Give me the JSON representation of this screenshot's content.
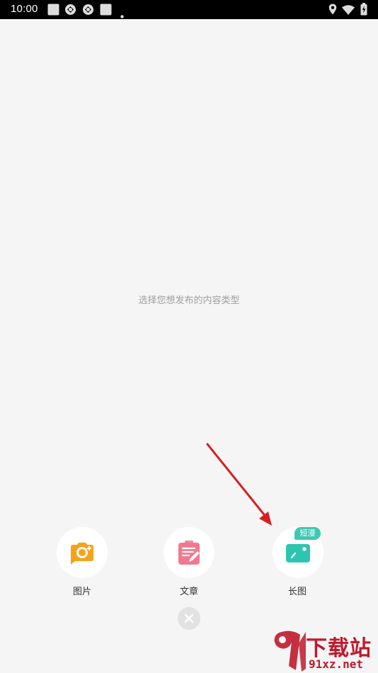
{
  "status_bar": {
    "time": "10:00",
    "left_icons": [
      "square-notification-icon",
      "sync-icon",
      "sync-icon",
      "square-notification-icon",
      "dot-icon"
    ],
    "right_icons": [
      "location-icon",
      "wifi-icon",
      "battery-icon"
    ]
  },
  "hint": "选择您想发布的内容类型",
  "options": [
    {
      "label": "图片",
      "icon": "camera-icon",
      "color": "#f6a21b"
    },
    {
      "label": "文章",
      "icon": "article-edit-icon",
      "color": "#ef5e7c"
    },
    {
      "label": "长图",
      "icon": "image-icon",
      "color": "#2cc5b2",
      "badge": "短漫"
    }
  ],
  "close": {
    "icon": "close-icon"
  },
  "watermark": {
    "text": "下载站",
    "url": "91xz.net"
  }
}
